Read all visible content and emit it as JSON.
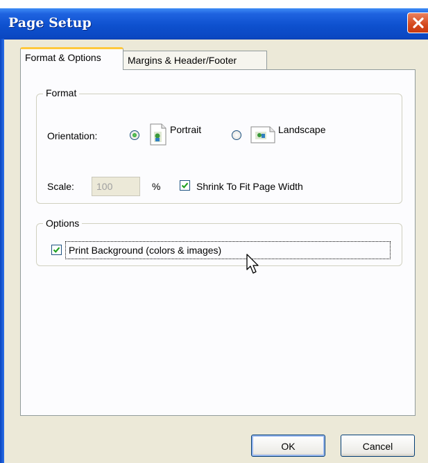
{
  "window": {
    "title": "Page Setup"
  },
  "tabs": [
    {
      "label": "Format & Options",
      "active": true
    },
    {
      "label": "Margins & Header/Footer",
      "active": false
    }
  ],
  "format": {
    "legend": "Format",
    "orientation_label": "Orientation:",
    "portrait_label": "Portrait",
    "landscape_label": "Landscape",
    "orientation_selected": "Portrait",
    "scale_label": "Scale:",
    "scale_value": "100",
    "scale_unit": "%",
    "shrink_label": "Shrink To Fit Page Width",
    "shrink_checked": true
  },
  "options": {
    "legend": "Options",
    "print_background_label": "Print Background (colors & images)",
    "print_background_checked": true
  },
  "buttons": {
    "ok": "OK",
    "cancel": "Cancel"
  },
  "colors": {
    "titlebar": "#0e51cf",
    "dialog_bg": "#ece9d8",
    "close_button": "#d4491d",
    "active_tab_highlight": "#ffc83c",
    "check_green": "#21a121"
  },
  "icons": {
    "close": "close-icon",
    "portrait": "portrait-page-icon",
    "landscape": "landscape-page-icon",
    "cursor": "mouse-pointer-icon"
  }
}
